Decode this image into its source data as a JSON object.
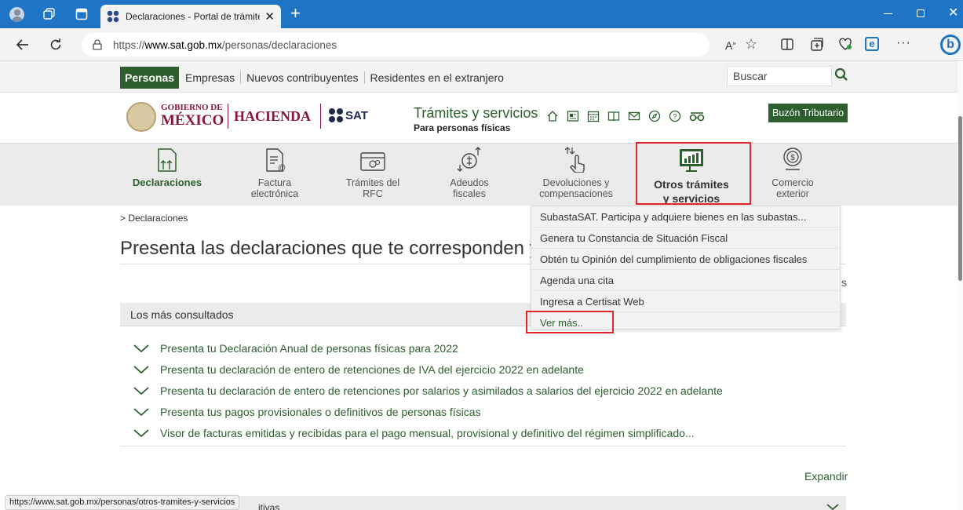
{
  "browser": {
    "tab_title": "Declaraciones - Portal de trámites",
    "url_prefix": "https://",
    "url_host": "www.sat.gob.mx",
    "url_path": "/personas/declaraciones",
    "status_url": "https://www.sat.gob.mx/personas/otros-tramites-y-servicios"
  },
  "topnav": {
    "items": [
      "Personas",
      "Empresas",
      "Nuevos contribuyentes",
      "Residentes en el extranjero"
    ],
    "search_placeholder": "Buscar"
  },
  "header": {
    "gob_line1": "GOBIERNO DE",
    "gob_line2": "MÉXICO",
    "hacienda": "HACIENDA",
    "sat": "SAT",
    "title": "Trámites y servicios",
    "subtitle": "Para personas físicas",
    "buzon": "Buzón Tributario"
  },
  "categories": [
    {
      "l1": "Declaraciones",
      "l2": ""
    },
    {
      "l1": "Factura",
      "l2": "electrónica"
    },
    {
      "l1": "Trámites del",
      "l2": "RFC"
    },
    {
      "l1": "Adeudos",
      "l2": "fiscales"
    },
    {
      "l1": "Devoluciones y",
      "l2": "compensaciones"
    },
    {
      "l1": "Otros trámites",
      "l2": "y servicios"
    },
    {
      "l1": "Comercio",
      "l2": "exterior"
    }
  ],
  "dropdown": [
    "SubastaSAT. Participa y adquiere bienes en las subastas...",
    "Genera tu Constancia de Situación Fiscal",
    "Obtén tu Opinión del cumplimiento de obligaciones fiscales",
    "Agenda una cita",
    "Ingresa a Certisat Web",
    "Ver más.."
  ],
  "main": {
    "breadcrumb": "> Declaraciones",
    "heading": "Presenta las declaraciones que te corresponden y re",
    "section_title": "Los más consultados",
    "links": [
      "Presenta tu Declaración Anual de personas físicas para 2022",
      "Presenta tu declaración de entero de retenciones de IVA del ejercicio 2022 en adelante",
      "Presenta tu declaración de entero de retenciones por salarios y asimilados a salarios del ejercicio 2022 en adelante",
      "Presenta tus pagos provisionales o definitivos de personas físicas",
      "Visor de facturas emitidas y recibidas para el pago mensual, provisional y definitivo del régimen simplificado..."
    ],
    "expand": "Expandir",
    "right_fragment": "s",
    "bottom_fragment": "itivas"
  },
  "colors": {
    "brand_green": "#2c5f2d",
    "highlight_red": "#e0262a",
    "chrome_blue": "#1f74c6"
  }
}
